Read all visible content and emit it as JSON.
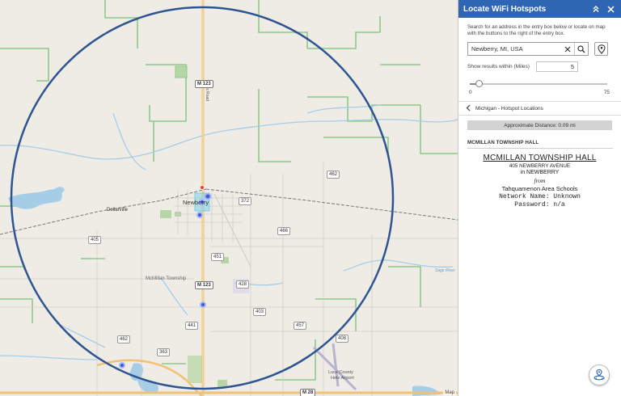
{
  "panel": {
    "title": "Locate WiFi Hotspots",
    "collapse_icon": "double-chevron-up-icon",
    "close_icon": "close-icon",
    "instructions": "Search for an address in the entry box below or locate on map with the buttons to the right of the entry box.",
    "search": {
      "value": "Newberry, MI, USA",
      "clear_icon": "close-icon",
      "search_icon": "search-icon",
      "locate_icon": "location-pin-icon"
    },
    "radius": {
      "label": "Show results within (Miles)",
      "value": "5",
      "slider_min": "0",
      "slider_max": "75",
      "slider_level": 5
    },
    "layer": {
      "back_icon": "chevron-left-icon",
      "name": "Michigan - Hotspot Locations"
    },
    "distance": "Approximate Distance: 0.09 mi",
    "result": {
      "header": "MCMILLAN TOWNSHIP HALL",
      "title": "MCMILLAN TOWNSHIP HALL",
      "address": "405 NEWBERRY AVENUE",
      "city": "in NEWBERRY",
      "from_label": "from",
      "provider": "Tahquamenon Area Schools",
      "network": "Network Name: Unknown",
      "password": "Password: n/a"
    }
  },
  "map": {
    "towns": {
      "newberry": "Newberry",
      "dollarville": "Dollarville"
    },
    "labels": {
      "township": "McMillan Township",
      "airport_line1": "Luce County",
      "airport_line2": "Hele Airport",
      "falls_road": "Falls Road",
      "sage_river": "Sage River"
    },
    "shields": {
      "m123_top": "M 123",
      "m123_mid": "M 123",
      "m28": "M 28",
      "r462_top": "462",
      "r372": "372",
      "r466": "466",
      "r405": "405",
      "r451": "451",
      "r428": "428",
      "r403": "403",
      "r441": "441",
      "r457": "457",
      "r408": "408",
      "r462_bot": "462",
      "r363": "363"
    },
    "attribution": "Map"
  },
  "fab_icon": "locate-hotspot-icon",
  "colors": {
    "header_blue": "#2f66b3",
    "circle_blue": "#2e5591",
    "boundary_green": "#8ec98a",
    "water_blue": "#a6cde6",
    "road_orange": "#f1c177",
    "hotspot_blue": "#3d5ad6"
  }
}
